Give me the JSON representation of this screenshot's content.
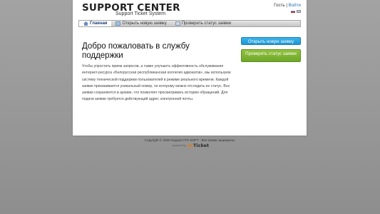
{
  "header": {
    "logo_title": "SUPPORT CENTER",
    "logo_subtitle": "Support Ticket System",
    "user_label": "Гость",
    "separator": "|",
    "login_link": "Войти"
  },
  "nav": {
    "items": [
      {
        "label": "Главная",
        "icon": "home-icon",
        "active": true
      },
      {
        "label": "Открыть новую заявку",
        "icon": "new-ticket-icon",
        "active": false
      },
      {
        "label": "Проверить статус заявки",
        "icon": "ticket-status-icon",
        "active": false
      }
    ]
  },
  "main": {
    "welcome_title": "Добро пожаловать в службу поддержки",
    "intro_text": "Чтобы упростить прием запросов, а также улучшить эффективность обслуживания интернет-ресурса «Белорусская республиканская коллегия адвокатов», мы используем систему технической поддержки пользователей в режиме реального времени. Каждой заявке присваивается уникальный номер, по которому можно отследить ее статус. Все заявки сохраняются в архиве, что позволяет просматривать историю обращений. Для подачи заявки требуется действующий адрес электронной почты."
  },
  "sidebar": {
    "open_ticket_button": "Открыть новую заявку",
    "check_status_button": "Проверить статус заявки"
  },
  "footer": {
    "copyright": "Copyright © 2025 Support ITG-SOFT - Все права защищены.",
    "powered_label": "powered by",
    "brand_o": "os",
    "brand_ticket": "Ticket"
  },
  "colors": {
    "blue_button": "#2aa5e0",
    "green_button": "#7fb532",
    "link": "#2a6fb0"
  }
}
